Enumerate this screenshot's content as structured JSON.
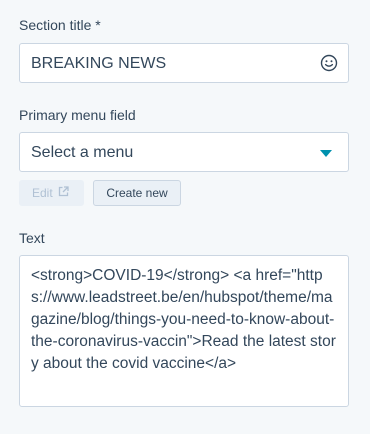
{
  "section_title": {
    "label": "Section title *",
    "value": "BREAKING NEWS",
    "emoji_icon": "smiley-icon"
  },
  "primary_menu": {
    "label": "Primary menu field",
    "selected": "Select a menu",
    "edit_label": "Edit",
    "edit_icon": "external-link-icon",
    "create_label": "Create new"
  },
  "text": {
    "label": "Text",
    "value": "<strong>COVID-19</strong> <a href=\"https://www.leadstreet.be/en/hubspot/theme/magazine/blog/things-you-need-to-know-about-the-coronavirus-vaccin\">Read the latest story about the covid vaccine</a>"
  },
  "colors": {
    "accent": "#0091ae",
    "text": "#33475b",
    "border": "#cbd6e2",
    "background": "#f5f8fa"
  }
}
